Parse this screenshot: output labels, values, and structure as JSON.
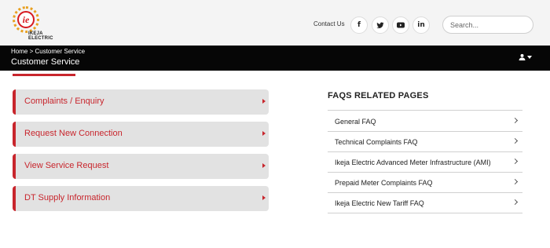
{
  "header": {
    "logo_text": "IKEJA ELECTRIC",
    "logo_mark": "ie",
    "contact_label": "Contact Us",
    "social": [
      {
        "icon": "facebook-icon",
        "glyph": "f"
      },
      {
        "icon": "twitter-icon",
        "glyph": "🐦"
      },
      {
        "icon": "youtube-icon",
        "glyph": "▶"
      },
      {
        "icon": "linkedin-icon",
        "glyph": "in"
      }
    ],
    "search_placeholder": "Search..."
  },
  "titlebar": {
    "breadcrumb_home": "Home",
    "breadcrumb_sep": ">",
    "breadcrumb_current": "Customer Service",
    "title": "Customer Service",
    "user_icon": "user-icon"
  },
  "services": [
    {
      "label": "Complaints / Enquiry"
    },
    {
      "label": "Request New Connection"
    },
    {
      "label": "View Service Request"
    },
    {
      "label": "DT Supply Information"
    }
  ],
  "faq": {
    "title": "FAQS RELATED PAGES",
    "items": [
      {
        "label": "General FAQ"
      },
      {
        "label": "Technical Complaints FAQ"
      },
      {
        "label": "Ikeja Electric Advanced Meter Infrastructure (AMI)"
      },
      {
        "label": "Prepaid Meter Complaints FAQ"
      },
      {
        "label": "Ikeja Electric New Tariff FAQ"
      }
    ]
  },
  "colors": {
    "accent_red": "#c8262d",
    "bar_black": "#060606",
    "header_bg": "#f4f4f4",
    "button_bg": "#e2e2e2",
    "logo_orange": "#e8a020"
  }
}
